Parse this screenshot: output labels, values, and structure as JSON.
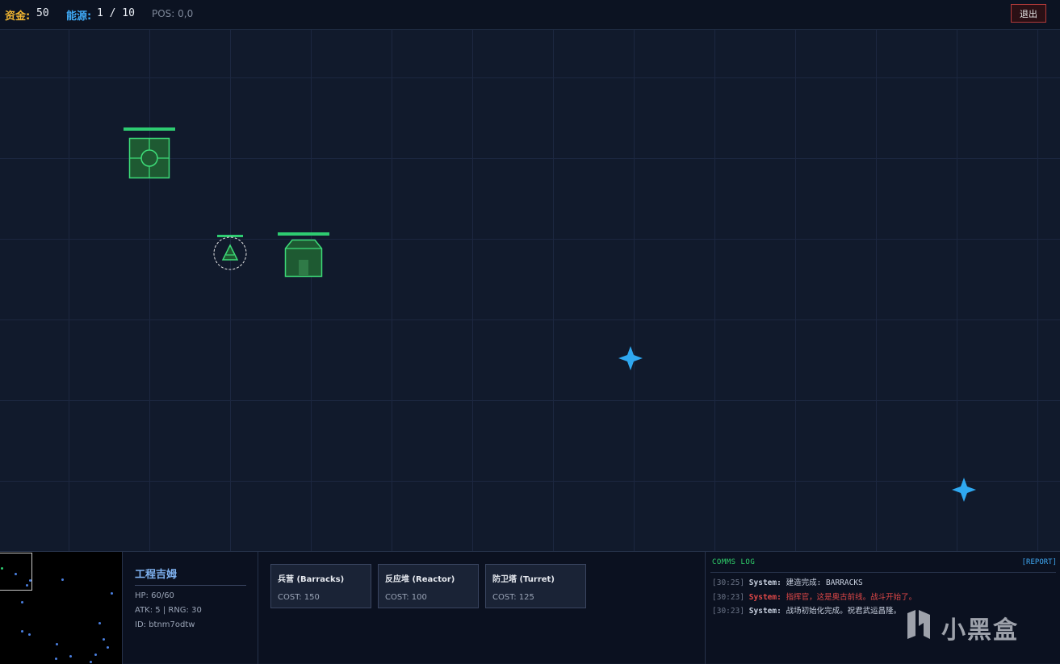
{
  "topbar": {
    "funds_label": "资金:",
    "funds_value": "50",
    "energy_label": "能源:",
    "energy_value": "1 / 10",
    "position_readout": "POS: 0,0",
    "exit_label": "退出"
  },
  "map": {
    "entities": [
      {
        "type": "command-center",
        "faction": "player",
        "icon": "command-center-icon",
        "health": 1.0
      },
      {
        "type": "engineer",
        "faction": "player",
        "icon": "engineer-unit-icon",
        "health": 1.0,
        "selected": true
      },
      {
        "type": "barracks",
        "faction": "player",
        "icon": "barracks-icon",
        "health": 1.0
      },
      {
        "type": "crystal",
        "icon": "crystal-resource-icon"
      },
      {
        "type": "crystal",
        "icon": "crystal-resource-icon"
      }
    ],
    "colors": {
      "player": "#2ecc71",
      "crystal": "#2fa8f0"
    }
  },
  "unit_panel": {
    "name": "工程吉姆",
    "hp": "HP: 60/60",
    "atk_rng": "ATK: 5 | RNG: 30",
    "id": "ID: btnm7odtw"
  },
  "build_menu": [
    {
      "name": "兵营 (Barracks)",
      "cost": "COST: 150"
    },
    {
      "name": "反应堆 (Reactor)",
      "cost": "COST: 100"
    },
    {
      "name": "防卫塔 (Turret)",
      "cost": "COST: 125"
    }
  ],
  "comms": {
    "title": "COMMS LOG",
    "report_label": "[REPORT]",
    "lines": [
      {
        "time": "[30:25]",
        "source": "System:",
        "message": "建造完成: BARRACKS",
        "kind": "system"
      },
      {
        "time": "[30:23]",
        "source": "System:",
        "message": "指挥官，这是奥古前线。战斗开始了。",
        "kind": "alert"
      },
      {
        "time": "[30:23]",
        "source": "System:",
        "message": "战场初始化完成。祝君武运昌隆。",
        "kind": "system"
      }
    ]
  },
  "watermark": {
    "text": "小黑盒",
    "icon": "xiaoheihe-logo-icon"
  }
}
